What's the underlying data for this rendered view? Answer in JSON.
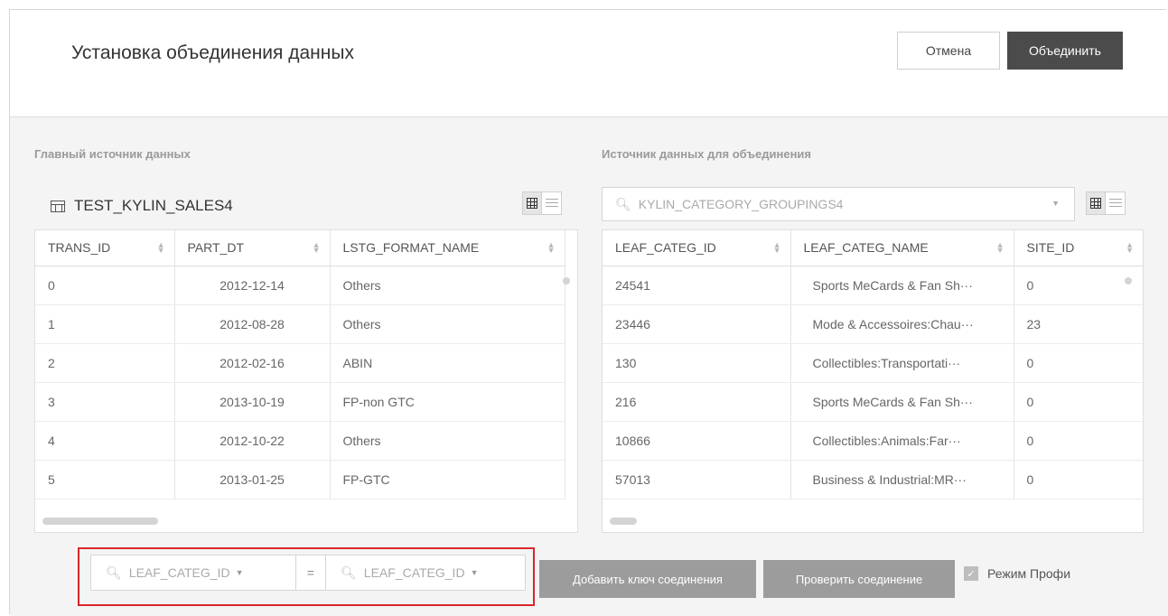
{
  "dialog": {
    "title": "Установка объединения данных",
    "cancel_label": "Отмена",
    "merge_label": "Объединить"
  },
  "main_source": {
    "section_label": "Главный источник данных",
    "name": "TEST_KYLIN_SALES4",
    "icon": "table-icon",
    "columns": [
      "TRANS_ID",
      "PART_DT",
      "LSTG_FORMAT_NAME"
    ],
    "rows": [
      [
        "0",
        "2012-12-14",
        "Others"
      ],
      [
        "1",
        "2012-08-28",
        "Others"
      ],
      [
        "2",
        "2012-02-16",
        "ABIN"
      ],
      [
        "3",
        "2013-10-19",
        "FP-non GTC"
      ],
      [
        "4",
        "2012-10-22",
        "Others"
      ],
      [
        "5",
        "2013-01-25",
        "FP-GTC"
      ]
    ]
  },
  "join_source": {
    "section_label": "Источник данных для объединения",
    "selected": "KYLIN_CATEGORY_GROUPINGS4",
    "columns": [
      "LEAF_CATEG_ID",
      "LEAF_CATEG_NAME",
      "SITE_ID"
    ],
    "rows": [
      [
        "24541",
        "Sports MeCards & Fan Sh···",
        "0"
      ],
      [
        "23446",
        "Mode & Accessoires:Chau···",
        "23"
      ],
      [
        "130",
        "Collectibles:Transportati···",
        "0"
      ],
      [
        "216",
        "Sports MeCards & Fan Sh···",
        "0"
      ],
      [
        "10866",
        "Collectibles:Animals:Far···",
        "0"
      ],
      [
        "57013",
        "Business & Industrial:MR···",
        "0"
      ]
    ]
  },
  "join_key": {
    "left_key": "LEAF_CATEG_ID",
    "operator": "=",
    "right_key": "LEAF_CATEG_ID",
    "add_key_label": "Добавить ключ соединения",
    "check_label": "Проверить соединение",
    "pro_mode_label": "Режим Профи",
    "pro_mode_checked": true
  },
  "colors": {
    "primary_button": "#4b4b4b",
    "highlight": "#d9262c",
    "secondary_button": "#9c9c9c"
  }
}
